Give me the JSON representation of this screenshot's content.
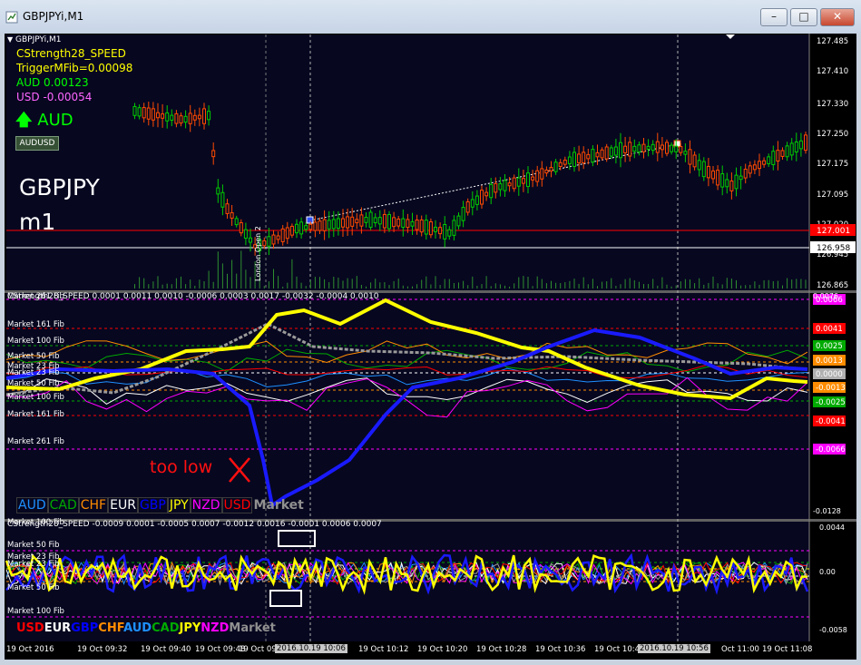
{
  "window": {
    "title": "GBPJPYi,M1",
    "minimize": "–",
    "maximize": "□",
    "close": "✕"
  },
  "main_chart": {
    "symbol_label": "GBPJPYi,M1",
    "indicator_name": "CStrength28_SPEED",
    "trigger": "TriggerMFib=0.00098",
    "aud_value": "AUD 0.00123",
    "usd_value": "USD -0.00054",
    "signal_label": "AUD",
    "pair_button": "AUDUSD",
    "big_symbol": "GBPJPY",
    "big_tf": "m1",
    "vline_label": "London Open 2",
    "price_labels": [
      "127.485",
      "127.410",
      "127.330",
      "127.250",
      "127.175",
      "127.095",
      "127.020",
      "126.945",
      "126.865"
    ],
    "red_line_price": "127.001",
    "white_line_price": "126.958",
    "colors": {
      "up": "#00ff00",
      "down": "#ff4000",
      "red_line": "#ff0000",
      "green_text": "#00ff00",
      "yellow_text": "#ffff00",
      "magenta_text": "#ff66ff"
    }
  },
  "panel1": {
    "header": "CStrength28_SPEED  0.0001  0.0011  0.0010  -0.0006  0.0003  0.0017  -0.0032  -0.0004  0.0010",
    "fib_labels": [
      "Market 261 Fib",
      "Market 161 Fib",
      "Market 100 Fib",
      "Market 50 Fib",
      "Market 23 Fib",
      "Market 23 Fib",
      "Market 50 Fib",
      "Market 100 Fib",
      "Market 161 Fib",
      "Market 261 Fib"
    ],
    "fib_left_extra": [
      "Market 38 Fib",
      "Market 23 Fib"
    ],
    "right_badges": [
      {
        "text": "0.0066",
        "color": "#ff00ff"
      },
      {
        "text": "0.0041",
        "color": "#ff0000"
      },
      {
        "text": "0.0025",
        "color": "#00aa00"
      },
      {
        "text": "0.0013",
        "color": "#ff8c00"
      },
      {
        "text": "0.0000",
        "color": "#b0b0b0"
      },
      {
        "text": "-0.0013",
        "color": "#ff8c00"
      },
      {
        "text": "-0.0025",
        "color": "#00aa00"
      },
      {
        "text": "-0.0041",
        "color": "#ff0000"
      },
      {
        "text": "-0.0066",
        "color": "#ff00ff"
      }
    ],
    "axis_top": "0.0076",
    "axis_bottom": "-0.0128",
    "annotation": "too low",
    "vline_label": "London Open 2",
    "legend": [
      {
        "text": "AUD",
        "color": "#1e90ff"
      },
      {
        "text": "CAD",
        "color": "#00aa00"
      },
      {
        "text": "CHF",
        "color": "#ff8c00"
      },
      {
        "text": "EUR",
        "color": "#ffffff"
      },
      {
        "text": "GBP",
        "color": "#0000ff"
      },
      {
        "text": "JPY",
        "color": "#ffff00"
      },
      {
        "text": "NZD",
        "color": "#ff00ff"
      },
      {
        "text": "USD",
        "color": "#ff0000"
      },
      {
        "text": "Market",
        "color": "#909090"
      }
    ]
  },
  "panel2": {
    "header": "CStrength28_SPEED  -0.0009  0.0001  -0.0005  0.0007  -0.0012  0.0016  -0.0001  0.0006  0.0007",
    "fib_labels": [
      "Market 100 Fib",
      "Market 50 Fib",
      "Market 23 Fib",
      "Market 23 Fib",
      "Market 50 Fib",
      "Market 100 Fib"
    ],
    "axis_top": "0.0044",
    "axis_zero": "0.00",
    "axis_bottom": "-0.0058",
    "vline_label": "London Open",
    "legend": [
      {
        "text": "USD",
        "color": "#ff0000"
      },
      {
        "text": "EUR",
        "color": "#ffffff"
      },
      {
        "text": "GBP",
        "color": "#0000ff"
      },
      {
        "text": "CHF",
        "color": "#ff8c00"
      },
      {
        "text": "AUD",
        "color": "#1e90ff"
      },
      {
        "text": "CAD",
        "color": "#00aa00"
      },
      {
        "text": "JPY",
        "color": "#ffff00"
      },
      {
        "text": "NZD",
        "color": "#ff00ff"
      },
      {
        "text": "Market",
        "color": "#909090"
      }
    ]
  },
  "time_axis": {
    "labels": [
      "19 Oct 2016",
      "19 Oct 09:32",
      "19 Oct 09:40",
      "19 Oct 09:48",
      "19 Oct 09",
      "19 Oct 10:12",
      "19 Oct 10:20",
      "19 Oct 10:28",
      "19 Oct 10:36",
      "19 Oct 10:44",
      "Oct 11:00",
      "19 Oct 11:08"
    ],
    "highlight1": "2016.10.19 10:06",
    "highlight2": "2016.10.19 10:56"
  }
}
